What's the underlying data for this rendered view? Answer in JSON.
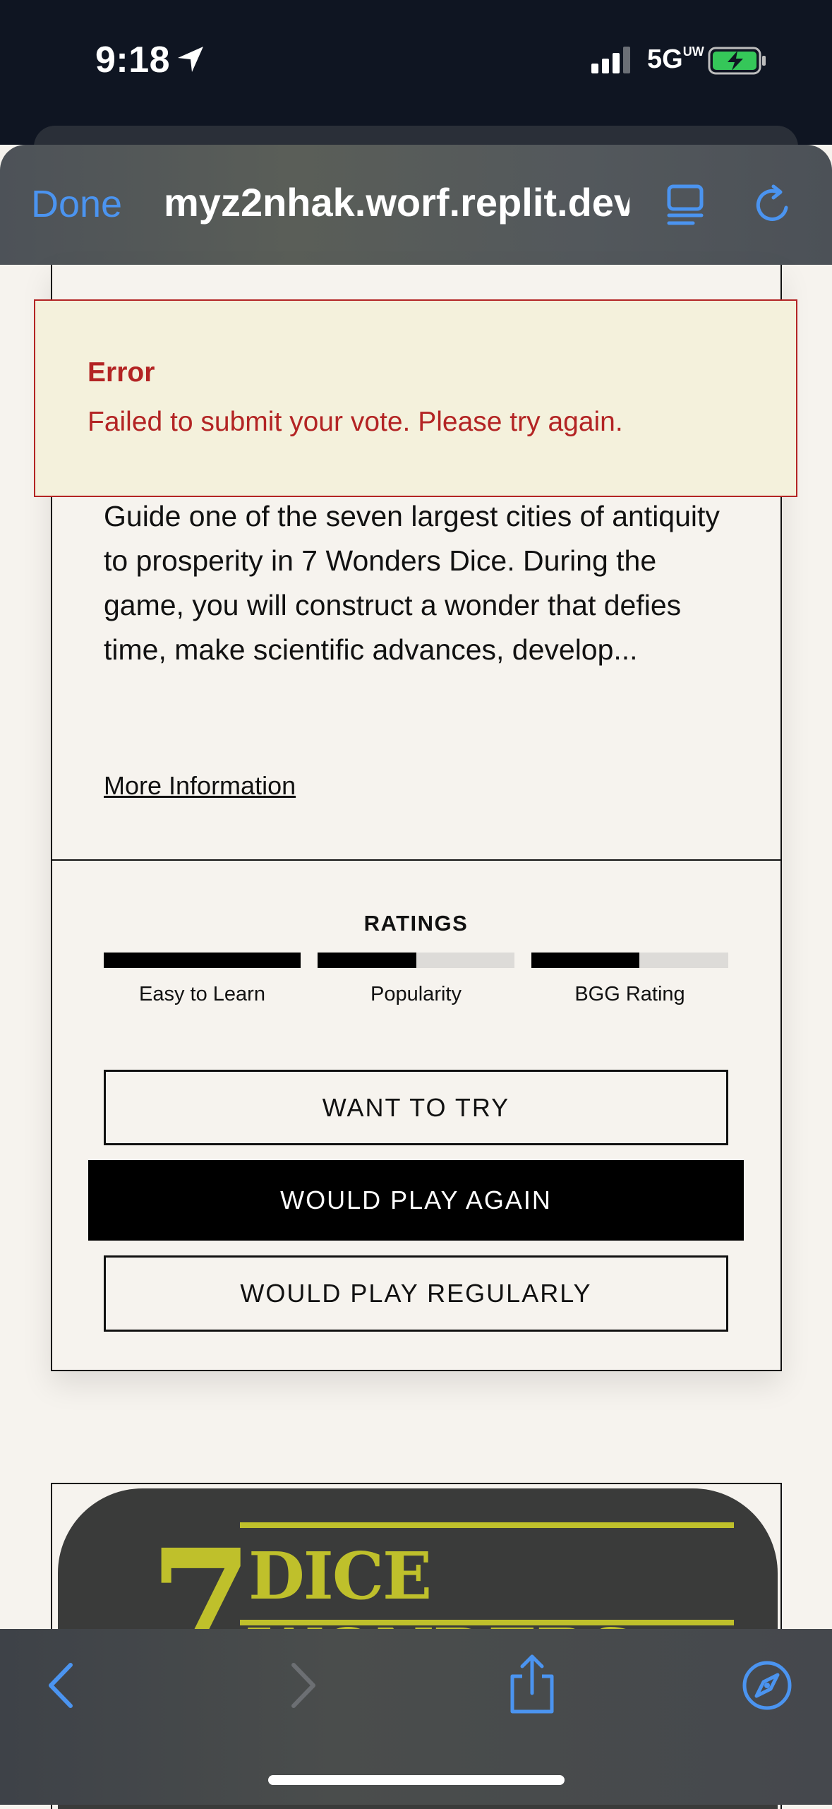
{
  "status_bar": {
    "time": "9:18",
    "network": "5G",
    "network_suffix": "UW",
    "icons": [
      "location-arrow-icon",
      "signal-bars-icon",
      "battery-charging-icon"
    ]
  },
  "browser": {
    "done_label": "Done",
    "url": "myz2nhak.worf.replit.dev",
    "icons": [
      "reader-view-icon",
      "reload-icon",
      "back-icon",
      "forward-icon",
      "share-icon",
      "safari-compass-icon"
    ],
    "accent_color": "#4b94f0"
  },
  "error": {
    "title": "Error",
    "message": "Failed to submit your vote. Please try again.",
    "color": "#b32424"
  },
  "game": {
    "description": "Guide one of the seven largest cities of antiquity to prosperity in 7 Wonders Dice. During the game, you will construct a wonder that defies time, make scientific advances, develop...",
    "more_info_label": "More Information",
    "ratings_title": "RATINGS",
    "ratings": [
      {
        "label": "Easy to Learn",
        "value": 1.0
      },
      {
        "label": "Popularity",
        "value": 0.5
      },
      {
        "label": "BGG Rating",
        "value": 0.55
      }
    ],
    "buttons": {
      "want_to_try": "WANT TO TRY",
      "would_play_again": "WOULD PLAY AGAIN",
      "would_play_regularly": "WOULD PLAY REGULARLY"
    }
  },
  "next_game": {
    "image_text_number": "7",
    "image_text_title": "DICE WONDERS"
  }
}
